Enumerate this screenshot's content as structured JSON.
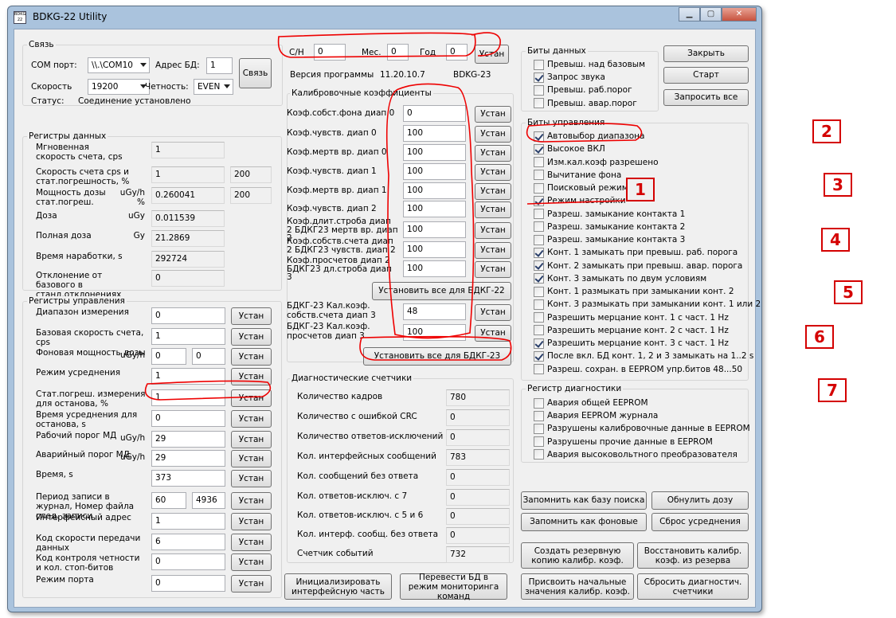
{
  "window": {
    "title": "BDKG-22 Utility",
    "icon_text": "BDKG 22"
  },
  "svyaz": {
    "title": "Связь",
    "com_label": "COM порт:",
    "com_value": "\\\\.\\COM10",
    "addr_label": "Адрес БД:",
    "addr_value": "1",
    "connect_btn": "Связь",
    "speed_label": "Скорость",
    "speed_value": "19200",
    "parity_label": "Четность:",
    "parity_value": "EVEN",
    "status_label": "Статус:",
    "status_value": "Соединение установлено"
  },
  "top": {
    "sn_label": "С/Н",
    "sn_value": "0",
    "month_label": "Мес.",
    "month_value": "0",
    "year_label": "Год",
    "year_value": "0",
    "set_btn": "Устан",
    "ver_label": "Версия программы",
    "ver_value": "11.20.10.7",
    "model": "BDKG-23"
  },
  "data_regs": {
    "title": "Регистры данных",
    "rows": [
      {
        "label": "Мгновенная скорость счета, cps",
        "unit": "",
        "v1": "1",
        "v2": ""
      },
      {
        "label": "Скорость счета cps и стат.погрешность, %",
        "unit": "",
        "v1": "1",
        "v2": "200"
      },
      {
        "label": "Мощность дозы стат.погреш.",
        "unit": "uGy/h %",
        "v1": "0.260041",
        "v2": "200"
      },
      {
        "label": "Доза",
        "unit": "uGy",
        "v1": "0.011539",
        "v2": ""
      },
      {
        "label": "Полная доза",
        "unit": "Gy",
        "v1": "21.2869",
        "v2": ""
      },
      {
        "label": "Время наработки, s",
        "unit": "",
        "v1": "292724",
        "v2": ""
      },
      {
        "label": "Отклонение от базового в станд.отклонениях",
        "unit": "",
        "v1": "0",
        "v2": ""
      }
    ]
  },
  "ctrl_regs": {
    "title": "Регистры управления",
    "btn": "Устан",
    "rows": [
      {
        "label": "Диапазон измерения",
        "unit": "",
        "v1": "0",
        "v2": ""
      },
      {
        "label": "Базовая скорость счета, cps",
        "unit": "",
        "v1": "1",
        "v2": ""
      },
      {
        "label": "Фоновая мощность дозы",
        "unit": "uGy/h",
        "v1": "0",
        "v2": "0"
      },
      {
        "label": "Режим усреднения",
        "unit": "",
        "v1": "1",
        "v2": ""
      },
      {
        "label": "Стат.погреш. измерения для останова, %",
        "unit": "",
        "v1": "1",
        "v2": ""
      },
      {
        "label": "Время усреднения для останова, s",
        "unit": "",
        "v1": "0",
        "v2": ""
      },
      {
        "label": "Рабочий порог МД",
        "unit": "uGy/h",
        "v1": "29",
        "v2": ""
      },
      {
        "label": "Аварийный порог МД",
        "unit": "uGy/h",
        "v1": "29",
        "v2": ""
      },
      {
        "label": "Время, s",
        "unit": "",
        "v1": "373",
        "v2": ""
      },
      {
        "label": "Период записи в журнал, Номер файла след. записи",
        "unit": "",
        "v1": "60",
        "v2": "4936"
      },
      {
        "label": "Интерфейсный адрес",
        "unit": "",
        "v1": "1",
        "v2": ""
      },
      {
        "label": "Код скорости передачи данных",
        "unit": "",
        "v1": "6",
        "v2": ""
      },
      {
        "label": "Код контроля четности и кол. стоп-битов",
        "unit": "",
        "v1": "0",
        "v2": ""
      },
      {
        "label": "Режим порта",
        "unit": "",
        "v1": "0",
        "v2": ""
      }
    ]
  },
  "calib": {
    "title": "Калибровочные коэффициенты",
    "btn": "Устан",
    "rows": [
      {
        "label": "Коэф.собст.фона диап 0",
        "value": "0"
      },
      {
        "label": "Коэф.чувств. диап 0",
        "value": "100"
      },
      {
        "label": "Коэф.мертв вр. диап 0",
        "value": "100"
      },
      {
        "label": "Коэф.чувств. диап 1",
        "value": "100"
      },
      {
        "label": "Коэф.мертв вр. диап 1",
        "value": "100"
      },
      {
        "label": "Коэф.чувств. диап 2",
        "value": "100"
      },
      {
        "label": "Коэф.длит.строба диап 2 БДКГ23 мертв вр. диап 2",
        "value": "100"
      },
      {
        "label": "Коэф.собств.счета диап 2 БДКГ23 чувств. диап 2",
        "value": "100"
      },
      {
        "label": "Коэф.просчетов диап 2 БДКГ23 дл.строба диап 3",
        "value": "100"
      }
    ],
    "set_all_22": "Установить все для БДКГ-22",
    "rows23": [
      {
        "label": "БДКГ-23 Кал.коэф. собств.счета диап 3",
        "value": "48"
      },
      {
        "label": "БДКГ-23 Кал.коэф. просчетов диап 3",
        "value": "100"
      }
    ],
    "set_all_23": "Установить все для БДКГ-23"
  },
  "diag_counters": {
    "title": "Диагностические счетчики",
    "rows": [
      {
        "label": "Количество кадров",
        "value": "780"
      },
      {
        "label": "Количество с ошибкой CRC",
        "value": "0"
      },
      {
        "label": "Количество ответов-исключений",
        "value": "0"
      },
      {
        "label": "Кол. интерфейсных сообщений",
        "value": "783"
      },
      {
        "label": "Кол. сообщений без ответа",
        "value": "0"
      },
      {
        "label": "Кол. ответов-исключ. с 7",
        "value": "0"
      },
      {
        "label": "Кол. ответов-исключ. с 5 и 6",
        "value": "0"
      },
      {
        "label": "Кол. интерф. сообщ. без ответа",
        "value": "0"
      },
      {
        "label": "Счетчик событий",
        "value": "732"
      }
    ]
  },
  "data_bits": {
    "title": "Биты данных",
    "items": [
      {
        "label": "Превыш. над базовым",
        "checked": false
      },
      {
        "label": "Запрос звука",
        "checked": true
      },
      {
        "label": "Превыш. раб.порог",
        "checked": false
      },
      {
        "label": "Превыш. авар.порог",
        "checked": false
      }
    ]
  },
  "ctrl_bits": {
    "title": "Биты управления",
    "items": [
      {
        "label": "Автовыбор диапазона",
        "checked": true
      },
      {
        "label": "Высокое ВКЛ",
        "checked": true
      },
      {
        "label": "Изм.кал.коэф разрешено",
        "checked": false
      },
      {
        "label": "Вычитание фона",
        "checked": false
      },
      {
        "label": "Поисковый режим",
        "checked": false
      },
      {
        "label": "Режим настройки",
        "checked": true
      },
      {
        "label": "Разреш. замыкание контакта 1",
        "checked": false
      },
      {
        "label": "Разреш. замыкание контакта 2",
        "checked": false
      },
      {
        "label": "Разреш. замыкание контакта 3",
        "checked": false
      },
      {
        "label": "Конт. 1 замыкать при превыш. раб. порога",
        "checked": true
      },
      {
        "label": "Конт. 2 замыкать при превыш. авар. порога",
        "checked": true
      },
      {
        "label": "Конт. 3 замыкать по двум условиям",
        "checked": true
      },
      {
        "label": "Конт. 1 размыкать при замыкании конт. 2",
        "checked": false
      },
      {
        "label": "Конт. 3 размыкать при замыкании конт. 1 или 2",
        "checked": false
      },
      {
        "label": "Разрешить мерцание конт. 1 с част. 1 Hz",
        "checked": false
      },
      {
        "label": "Разрешить мерцание конт. 2 с част. 1 Hz",
        "checked": false
      },
      {
        "label": "Разрешить мерцание конт. 3 с част. 1 Hz",
        "checked": true
      },
      {
        "label": "После вкл. БД конт. 1, 2 и 3 замыкать на 1..2 s",
        "checked": true
      },
      {
        "label": "Разреш. сохран. в EEPROM упр.битов 48...50",
        "checked": false
      }
    ]
  },
  "diag_reg": {
    "title": "Регистр диагностики",
    "items": [
      {
        "label": "Авария общей EEPROM",
        "checked": false
      },
      {
        "label": "Авария EEPROM журнала",
        "checked": false
      },
      {
        "label": "Разрушены калибровочные данные в EEPROM",
        "checked": false
      },
      {
        "label": "Разрушены прочие данные в EEPROM",
        "checked": false
      },
      {
        "label": "Авария высоковольтного преобразователя",
        "checked": false
      }
    ]
  },
  "right_buttons": {
    "close": "Закрыть",
    "start": "Старт",
    "request_all": "Запросить все"
  },
  "bottom_buttons": {
    "remember_base": "Запомнить как базу поиска",
    "reset_dose": "Обнулить дозу",
    "remember_bg": "Запомнить как фоновые",
    "reset_avg": "Сброс усреднения",
    "backup": "Создать резервную копию калибр. коэф.",
    "restore": "Восстановить калибр. коэф. из резерва",
    "assign_init": "Присвоить начальные значения калибр. коэф.",
    "reset_diag": "Сбросить диагностич. счетчики",
    "init_iface": "Инициализировать интерфейсную часть",
    "monitor_mode": "Перевести БД в режим мониторинга команд"
  },
  "annotations": [
    "1",
    "2",
    "3",
    "4",
    "5",
    "6",
    "7"
  ],
  "annotation_color": "#d40000"
}
